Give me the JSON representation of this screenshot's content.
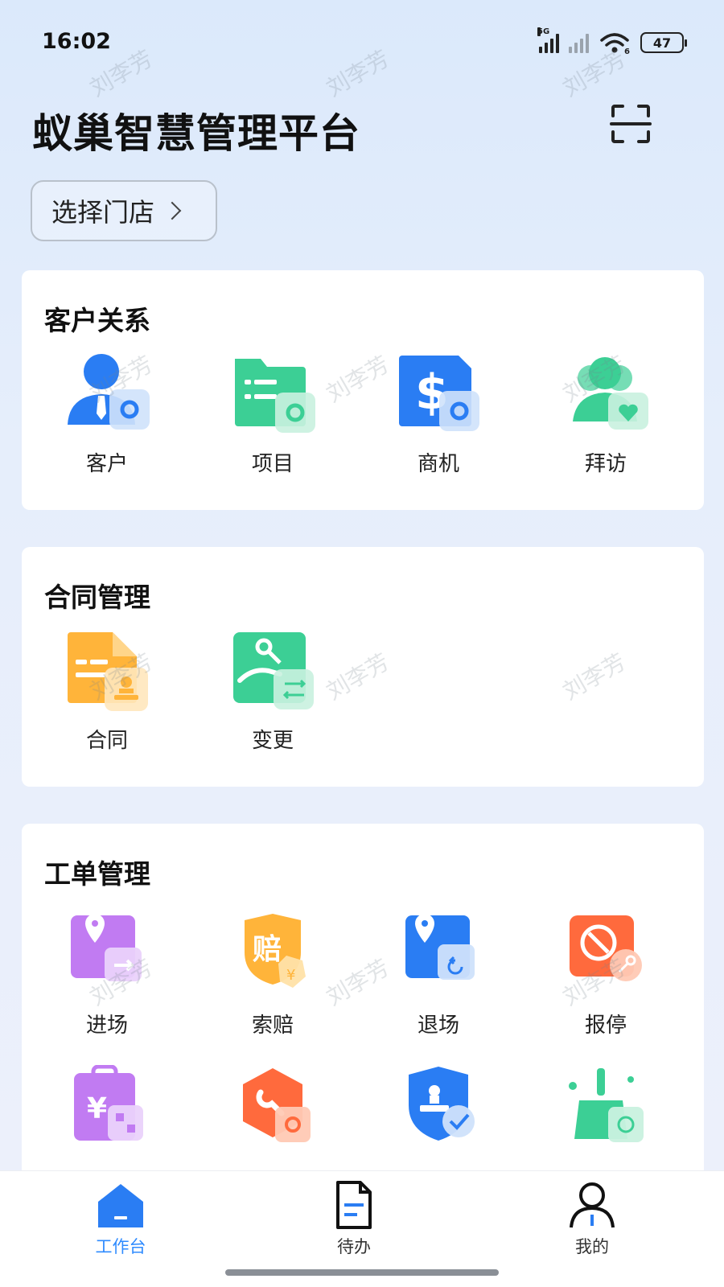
{
  "status_bar": {
    "time": "16:02",
    "network": "5G",
    "battery": "47",
    "wifi_badge": "6"
  },
  "header": {
    "title": "蚁巢智慧管理平台",
    "store_select_label": "选择门店"
  },
  "watermark_text": "刘李芳",
  "sections": [
    {
      "title": "客户关系",
      "items": [
        {
          "label": "客户",
          "icon": "customer-icon"
        },
        {
          "label": "项目",
          "icon": "project-folder-icon"
        },
        {
          "label": "商机",
          "icon": "opportunity-dollar-icon"
        },
        {
          "label": "拜访",
          "icon": "visit-icon"
        }
      ]
    },
    {
      "title": "合同管理",
      "items": [
        {
          "label": "合同",
          "icon": "contract-icon"
        },
        {
          "label": "变更",
          "icon": "change-key-icon"
        }
      ]
    },
    {
      "title": "工单管理",
      "items": [
        {
          "label": "进场",
          "icon": "enter-site-icon"
        },
        {
          "label": "索赔",
          "icon": "claim-shield-icon"
        },
        {
          "label": "退场",
          "icon": "exit-site-icon"
        },
        {
          "label": "报停",
          "icon": "suspend-icon"
        },
        {
          "label": "",
          "icon": "fee-clipboard-icon"
        },
        {
          "label": "",
          "icon": "repair-wrench-icon"
        },
        {
          "label": "",
          "icon": "stamp-shield-icon"
        },
        {
          "label": "",
          "icon": "cleaning-icon"
        }
      ]
    }
  ],
  "colors": {
    "active_tab": "#2f8bff",
    "blue": "#2a7df3",
    "green": "#3ccf95",
    "orange": "#ffb43a",
    "purple": "#c17bf2",
    "red": "#ff6a3d"
  },
  "tabbar": [
    {
      "label": "工作台",
      "icon": "workbench-home-icon",
      "active": true
    },
    {
      "label": "待办",
      "icon": "todo-document-icon",
      "active": false
    },
    {
      "label": "我的",
      "icon": "profile-person-icon",
      "active": false
    }
  ]
}
